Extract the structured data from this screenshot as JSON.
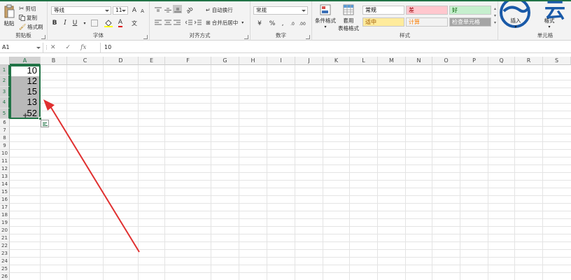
{
  "ribbon": {
    "clipboard": {
      "paste": "粘贴",
      "cut": "剪切",
      "copy": "复制",
      "format_painter": "格式刷",
      "group_label": "剪贴板"
    },
    "font": {
      "font_name": "等线",
      "font_size": "11",
      "bold": "B",
      "italic": "I",
      "underline": "U",
      "font_color": "A",
      "group_label": "字体"
    },
    "alignment": {
      "wrap_text": "自动换行",
      "merge_center": "合并后居中",
      "group_label": "对齐方式"
    },
    "number": {
      "format": "常规",
      "currency": "¥",
      "percent": "%",
      "group_label": "数字"
    },
    "styles": {
      "conditional_format": "条件格式",
      "table_format_line1": "套用",
      "table_format_line2": "表格格式",
      "group_label": "样式",
      "cells": [
        {
          "label": "常规",
          "bg": "#ffffff",
          "fg": "#000000"
        },
        {
          "label": "差",
          "bg": "#ffc7ce",
          "fg": "#9c0006"
        },
        {
          "label": "好",
          "bg": "#c6efce",
          "fg": "#006100"
        },
        {
          "label": "适中",
          "bg": "#ffeb9c",
          "fg": "#9c5700"
        },
        {
          "label": "计算",
          "bg": "#f2f2f2",
          "fg": "#fa7d00"
        },
        {
          "label": "检查单元格",
          "bg": "#a5a5a5",
          "fg": "#ffffff"
        }
      ]
    },
    "cells": {
      "insert": "插入",
      "format": "格式",
      "group_label": "单元格"
    },
    "watermark": "云"
  },
  "formula_bar": {
    "name_box": "A1",
    "cancel": "✕",
    "enter": "✓",
    "fx": "fx",
    "value": "10"
  },
  "columns": [
    "A",
    "B",
    "C",
    "D",
    "E",
    "F",
    "G",
    "H",
    "I",
    "J",
    "K",
    "L",
    "M",
    "N",
    "O",
    "P",
    "Q",
    "R",
    "S"
  ],
  "rows": [
    "1",
    "2",
    "3",
    "4",
    "5",
    "6",
    "7",
    "8",
    "9",
    "10",
    "11",
    "12",
    "13",
    "14",
    "15",
    "16",
    "17",
    "18",
    "19",
    "20",
    "21",
    "22",
    "23",
    "24",
    "25",
    "26"
  ],
  "cells": {
    "A1": "10",
    "A2": "12",
    "A3": "15",
    "A4": "13",
    "A5": "52"
  },
  "accent": "#217346",
  "annotation_color": "#e03030"
}
